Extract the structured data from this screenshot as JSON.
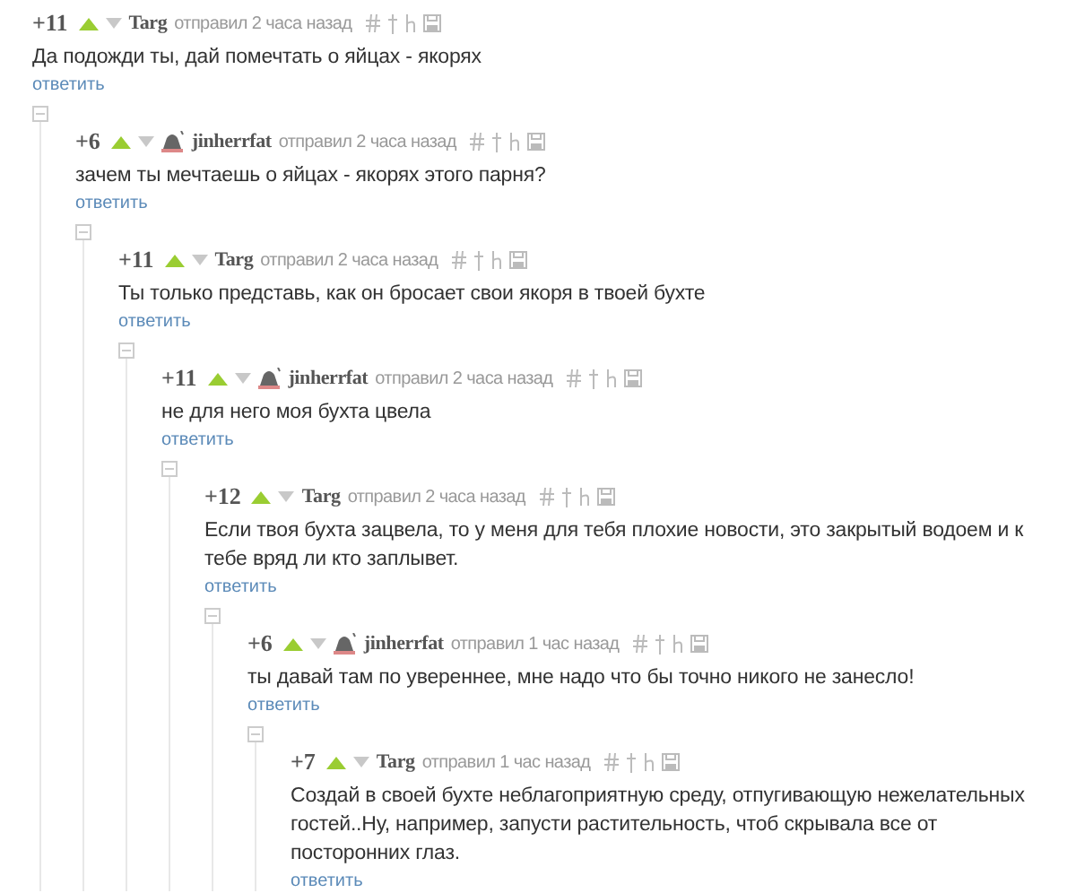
{
  "comment": {
    "rating": "+11",
    "author": "Targ",
    "has_avatar": false,
    "posted": "отправил 2 часа назад",
    "text": "Да подожди ты, дай помечтать о яйцах - якорях",
    "reply": "ответить",
    "children": [
      {
        "rating": "+6",
        "author": "jinherrfat",
        "has_avatar": true,
        "posted": "отправил 2 часа назад",
        "text": "зачем ты мечтаешь о яйцах - якорях этого парня?",
        "reply": "ответить",
        "children": [
          {
            "rating": "+11",
            "author": "Targ",
            "has_avatar": false,
            "posted": "отправил 2 часа назад",
            "text": "Ты только представь, как он бросает свои якоря в твоей бухте",
            "reply": "ответить",
            "children": [
              {
                "rating": "+11",
                "author": "jinherrfat",
                "has_avatar": true,
                "posted": "отправил 2 часа назад",
                "text": "не для него моя бухта цвела",
                "reply": "ответить",
                "children": [
                  {
                    "rating": "+12",
                    "author": "Targ",
                    "has_avatar": false,
                    "posted": "отправил 2 часа назад",
                    "text": "Если твоя бухта зацвела, то у меня для тебя плохие новости, это закрытый водоем и к тебе вряд ли кто заплывет.",
                    "reply": "ответить",
                    "children": [
                      {
                        "rating": "+6",
                        "author": "jinherrfat",
                        "has_avatar": true,
                        "posted": "отправил 1 час назад",
                        "text": "ты давай там по увереннее, мне надо что бы точно никого не занесло!",
                        "reply": "ответить",
                        "children": [
                          {
                            "rating": "+7",
                            "author": "Targ",
                            "has_avatar": false,
                            "posted": "отправил 1 час назад",
                            "text": "Создай в своей бухте неблагоприятную среду, отпугивающую нежелательных гостей..Ну, например, запусти растительность, чтоб скрывала все от посторонних глаз.",
                            "reply": "ответить"
                          }
                        ]
                      }
                    ]
                  }
                ]
              }
            ]
          }
        ]
      }
    ]
  }
}
